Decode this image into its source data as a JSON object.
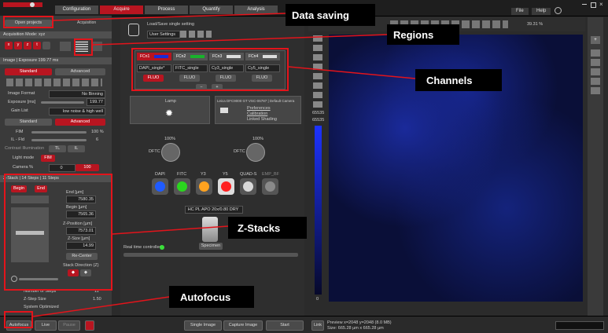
{
  "app": {
    "tabs": [
      "Configuration",
      "Acquire",
      "Process",
      "Quantify",
      "Analysis"
    ],
    "active_tab": "Acquire",
    "menu": [
      "File",
      "Help"
    ]
  },
  "left": {
    "open_projects": "Open projects",
    "acquisition": "Acquisition",
    "acq_mode_label": "Acquisition Mode: xyz",
    "mode_letters": [
      "x",
      "y",
      "z",
      "t"
    ],
    "image_header": "Image | Exposure 199.77 ms",
    "standard": "Standard",
    "advanced": "Advanced",
    "image_format_label": "Image Format",
    "image_format_value": "No Binning",
    "exposure_label": "Exposure [ms]",
    "exposure_value": "199.77",
    "gain_label": "Gain List",
    "gain_value": "low noise & high well",
    "fim_label": "FIM",
    "fim_value": "100 %",
    "il_field_label": "IL - Fld",
    "il_field_value": "6",
    "contr_label": "Contrast Illumination",
    "tl": "TL",
    "il": "IL",
    "light_mode_label": "Light mode",
    "light_mode_value": "FIM",
    "camera_label": "Camera %",
    "camera_min": "0",
    "camera_max": "100",
    "zstack_header": "Z-Stack | 14 Steps | 11 Steps",
    "begin": "Begin",
    "end": "End",
    "end_label": "End [µm]",
    "end_value": "7580.35",
    "begin_label": "Begin [µm]",
    "begin_value": "7565.36",
    "zpos_label": "Z-Position [µm]",
    "zpos_value": "7573.01",
    "zsize_label": "Z-Size [µm]",
    "zsize_value": "14.99",
    "recenter": "Re-Center",
    "stack_direction": "Stack Direction (Z)",
    "num_steps_label": "Number of Steps",
    "num_steps_value": "11",
    "z_step_label": "Z-Step Size",
    "z_step_value": "1.50",
    "system_optimized": "System Optimized"
  },
  "center": {
    "load_save": "Load/Save single setting",
    "user_settings": "User Settings",
    "channels": [
      {
        "name": "FCn1",
        "cube": "DAPI_single*",
        "fluo": "FLUO",
        "color": "#1a2bd6"
      },
      {
        "name": "FCn2",
        "cube": "FITC_single",
        "fluo": "FLUO",
        "color": "#19b32c"
      },
      {
        "name": "FCn3",
        "cube": "Cy3_single",
        "fluo": "FLUO",
        "color": "#d9a11a"
      },
      {
        "name": "FCn4",
        "cube": "Cy5_single",
        "fluo": "FLUO",
        "color": "#d11a1a"
      }
    ],
    "minus": "−",
    "plus": "+",
    "lamp": "Lamp",
    "camera": "Leica DFC9000 GT VSC-06787 | Default Camera",
    "preferences": "Preferences",
    "calibration": "Calibration",
    "linked_shading": "Linked Shading",
    "pct_left": "100%",
    "pct_right": "100%",
    "dftc": "DFTC",
    "filters": [
      {
        "label": "DAPI",
        "color": "#1f5bff"
      },
      {
        "label": "FITC",
        "color": "#2bd61f"
      },
      {
        "label": "Y3",
        "color": "#ffa21f"
      },
      {
        "label": "Y5",
        "color": "#ff2020"
      },
      {
        "label": "QUAD-S",
        "color": "#d8d8d8"
      },
      {
        "label": "EMP_BF",
        "color": "#8a8a8a"
      }
    ],
    "objective": "HC PL APO 20x/0.80 DRY",
    "specimen": "Specimen",
    "realtime": "Real time controlled"
  },
  "image": {
    "zoom": "39.31 %",
    "scale_max": "65535",
    "scale_max2": "65535",
    "scale_min": "0",
    "preview": "Preview x=2048 y=2048 (8.0 MB)",
    "size": "Size: 665.28 µm x 665.28 µm",
    "link": "Link"
  },
  "bottom": {
    "autofocus": "Autofocus",
    "live": "Live",
    "pause": "Pause",
    "single_image": "Single Image",
    "capture_image": "Capture Image",
    "start": "Start"
  },
  "annotations": {
    "data_saving": "Data saving",
    "regions": "Regions",
    "channels": "Channels",
    "zstacks": "Z-Stacks",
    "autofocus": "Autofocus"
  },
  "colors": {
    "accent": "#b81520",
    "annotation_red": "#e3141b"
  }
}
